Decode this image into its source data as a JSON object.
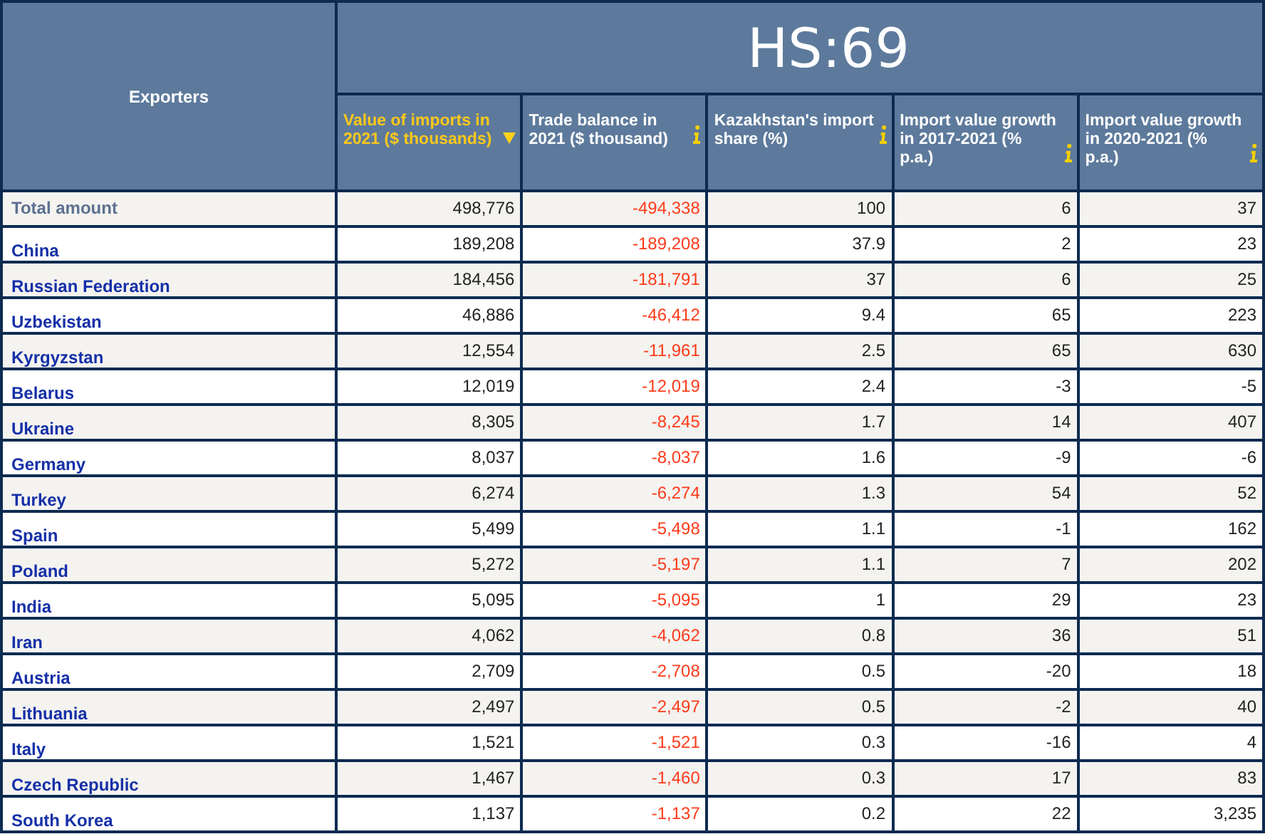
{
  "title": "HS:69",
  "row_header": "Exporters",
  "columns": [
    {
      "label": "Value of imports in 2021 ($ thousands)",
      "sorted": true,
      "info": false
    },
    {
      "label": "Trade balance in 2021 ($ thousand)",
      "sorted": false,
      "info": true
    },
    {
      "label": "Kazakhstan's import share (%)",
      "sorted": false,
      "info": true
    },
    {
      "label": "Import value growth in 2017-2021 (% p.a.)",
      "sorted": false,
      "info": true
    },
    {
      "label": "Import value growth in 2020-2021 (% p.a.)",
      "sorted": false,
      "info": true
    }
  ],
  "rows": [
    {
      "kind": "total",
      "name": "Total amount",
      "cells": [
        "498,776",
        "-494,338",
        "100",
        "6",
        "37"
      ]
    },
    {
      "kind": "country",
      "name": "China",
      "cells": [
        "189,208",
        "-189,208",
        "37.9",
        "2",
        "23"
      ]
    },
    {
      "kind": "country",
      "name": "Russian Federation",
      "cells": [
        "184,456",
        "-181,791",
        "37",
        "6",
        "25"
      ]
    },
    {
      "kind": "country",
      "name": "Uzbekistan",
      "cells": [
        "46,886",
        "-46,412",
        "9.4",
        "65",
        "223"
      ]
    },
    {
      "kind": "country",
      "name": "Kyrgyzstan",
      "cells": [
        "12,554",
        "-11,961",
        "2.5",
        "65",
        "630"
      ]
    },
    {
      "kind": "country",
      "name": "Belarus",
      "cells": [
        "12,019",
        "-12,019",
        "2.4",
        "-3",
        "-5"
      ]
    },
    {
      "kind": "country",
      "name": "Ukraine",
      "cells": [
        "8,305",
        "-8,245",
        "1.7",
        "14",
        "407"
      ]
    },
    {
      "kind": "country",
      "name": "Germany",
      "cells": [
        "8,037",
        "-8,037",
        "1.6",
        "-9",
        "-6"
      ]
    },
    {
      "kind": "country",
      "name": "Turkey",
      "cells": [
        "6,274",
        "-6,274",
        "1.3",
        "54",
        "52"
      ]
    },
    {
      "kind": "country",
      "name": "Spain",
      "cells": [
        "5,499",
        "-5,498",
        "1.1",
        "-1",
        "162"
      ]
    },
    {
      "kind": "country",
      "name": "Poland",
      "cells": [
        "5,272",
        "-5,197",
        "1.1",
        "7",
        "202"
      ]
    },
    {
      "kind": "country",
      "name": "India",
      "cells": [
        "5,095",
        "-5,095",
        "1",
        "29",
        "23"
      ]
    },
    {
      "kind": "country",
      "name": "Iran",
      "cells": [
        "4,062",
        "-4,062",
        "0.8",
        "36",
        "51"
      ]
    },
    {
      "kind": "country",
      "name": "Austria",
      "cells": [
        "2,709",
        "-2,708",
        "0.5",
        "-20",
        "18"
      ]
    },
    {
      "kind": "country",
      "name": "Lithuania",
      "cells": [
        "2,497",
        "-2,497",
        "0.5",
        "-2",
        "40"
      ]
    },
    {
      "kind": "country",
      "name": "Italy",
      "cells": [
        "1,521",
        "-1,521",
        "0.3",
        "-16",
        "4"
      ]
    },
    {
      "kind": "country",
      "name": "Czech Republic",
      "cells": [
        "1,467",
        "-1,460",
        "0.3",
        "17",
        "83"
      ]
    },
    {
      "kind": "country",
      "name": "South Korea",
      "cells": [
        "1,137",
        "-1,137",
        "0.2",
        "22",
        "3,235"
      ]
    }
  ]
}
